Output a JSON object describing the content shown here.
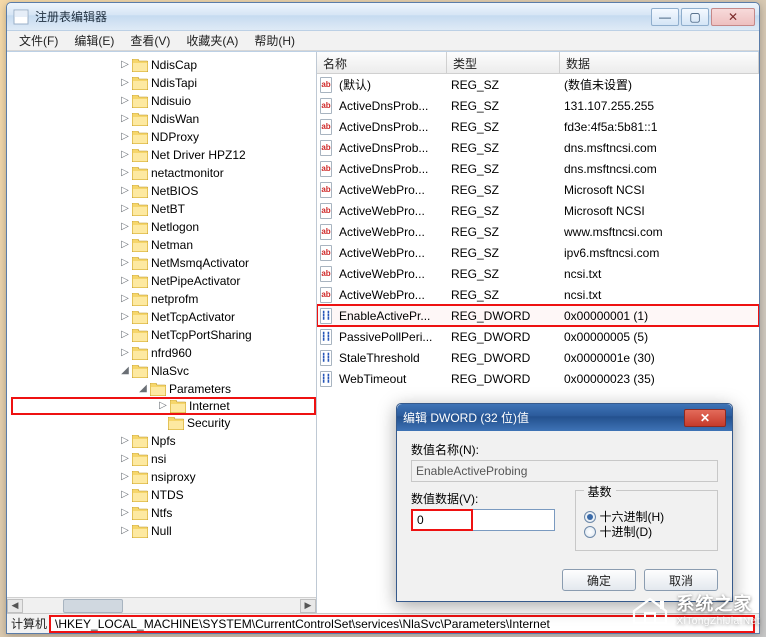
{
  "window": {
    "title": "注册表编辑器"
  },
  "menu": [
    "文件(F)",
    "编辑(E)",
    "查看(V)",
    "收藏夹(A)",
    "帮助(H)"
  ],
  "tree": [
    {
      "d": 0,
      "exp": "▷",
      "label": "NdisCap"
    },
    {
      "d": 0,
      "exp": "▷",
      "label": "NdisTapi"
    },
    {
      "d": 0,
      "exp": "▷",
      "label": "Ndisuio"
    },
    {
      "d": 0,
      "exp": "▷",
      "label": "NdisWan"
    },
    {
      "d": 0,
      "exp": "▷",
      "label": "NDProxy"
    },
    {
      "d": 0,
      "exp": "▷",
      "label": "Net Driver HPZ12"
    },
    {
      "d": 0,
      "exp": "▷",
      "label": "netactmonitor"
    },
    {
      "d": 0,
      "exp": "▷",
      "label": "NetBIOS"
    },
    {
      "d": 0,
      "exp": "▷",
      "label": "NetBT"
    },
    {
      "d": 0,
      "exp": "▷",
      "label": "Netlogon"
    },
    {
      "d": 0,
      "exp": "▷",
      "label": "Netman"
    },
    {
      "d": 0,
      "exp": "▷",
      "label": "NetMsmqActivator"
    },
    {
      "d": 0,
      "exp": "▷",
      "label": "NetPipeActivator"
    },
    {
      "d": 0,
      "exp": "▷",
      "label": "netprofm"
    },
    {
      "d": 0,
      "exp": "▷",
      "label": "NetTcpActivator"
    },
    {
      "d": 0,
      "exp": "▷",
      "label": "NetTcpPortSharing"
    },
    {
      "d": 0,
      "exp": "▷",
      "label": "nfrd960"
    },
    {
      "d": 0,
      "exp": "◢",
      "label": "NlaSvc"
    },
    {
      "d": 1,
      "exp": "◢",
      "label": "Parameters"
    },
    {
      "d": 2,
      "exp": "▷",
      "label": "Internet",
      "hi": true
    },
    {
      "d": 2,
      "exp": "",
      "label": "Security"
    },
    {
      "d": 0,
      "exp": "▷",
      "label": "Npfs"
    },
    {
      "d": 0,
      "exp": "▷",
      "label": "nsi"
    },
    {
      "d": 0,
      "exp": "▷",
      "label": "nsiproxy"
    },
    {
      "d": 0,
      "exp": "▷",
      "label": "NTDS"
    },
    {
      "d": 0,
      "exp": "▷",
      "label": "Ntfs"
    },
    {
      "d": 0,
      "exp": "▷",
      "label": "Null"
    }
  ],
  "columns": {
    "name": "名称",
    "type": "类型",
    "data": "数据"
  },
  "rows": [
    {
      "icon": "sz",
      "name": "(默认)",
      "type": "REG_SZ",
      "data": "(数值未设置)"
    },
    {
      "icon": "sz",
      "name": "ActiveDnsProb...",
      "type": "REG_SZ",
      "data": "131.107.255.255"
    },
    {
      "icon": "sz",
      "name": "ActiveDnsProb...",
      "type": "REG_SZ",
      "data": "fd3e:4f5a:5b81::1"
    },
    {
      "icon": "sz",
      "name": "ActiveDnsProb...",
      "type": "REG_SZ",
      "data": "dns.msftncsi.com"
    },
    {
      "icon": "sz",
      "name": "ActiveDnsProb...",
      "type": "REG_SZ",
      "data": "dns.msftncsi.com"
    },
    {
      "icon": "sz",
      "name": "ActiveWebPro...",
      "type": "REG_SZ",
      "data": "Microsoft NCSI"
    },
    {
      "icon": "sz",
      "name": "ActiveWebPro...",
      "type": "REG_SZ",
      "data": "Microsoft NCSI"
    },
    {
      "icon": "sz",
      "name": "ActiveWebPro...",
      "type": "REG_SZ",
      "data": "www.msftncsi.com"
    },
    {
      "icon": "sz",
      "name": "ActiveWebPro...",
      "type": "REG_SZ",
      "data": "ipv6.msftncsi.com"
    },
    {
      "icon": "sz",
      "name": "ActiveWebPro...",
      "type": "REG_SZ",
      "data": "ncsi.txt"
    },
    {
      "icon": "sz",
      "name": "ActiveWebPro...",
      "type": "REG_SZ",
      "data": "ncsi.txt"
    },
    {
      "icon": "dw",
      "name": "EnableActivePr...",
      "type": "REG_DWORD",
      "data": "0x00000001 (1)",
      "hi": true
    },
    {
      "icon": "dw",
      "name": "PassivePollPeri...",
      "type": "REG_DWORD",
      "data": "0x00000005 (5)"
    },
    {
      "icon": "dw",
      "name": "StaleThreshold",
      "type": "REG_DWORD",
      "data": "0x0000001e (30)"
    },
    {
      "icon": "dw",
      "name": "WebTimeout",
      "type": "REG_DWORD",
      "data": "0x00000023 (35)"
    }
  ],
  "status": {
    "label": "计算机",
    "path": "\\HKEY_LOCAL_MACHINE\\SYSTEM\\CurrentControlSet\\services\\NlaSvc\\Parameters\\Internet"
  },
  "dialog": {
    "title": "编辑 DWORD (32 位)值",
    "name_label": "数值名称(N):",
    "name_value": "EnableActiveProbing",
    "data_label": "数值数据(V):",
    "data_value": "0",
    "base_label": "基数",
    "hex": "十六进制(H)",
    "dec": "十进制(D)",
    "ok": "确定",
    "cancel": "取消"
  },
  "watermark": {
    "line1": "系统之家",
    "line2": "XiTongZhiJia.Net"
  },
  "icon_text": {
    "sz": "ab",
    "dw": "011\n110"
  }
}
